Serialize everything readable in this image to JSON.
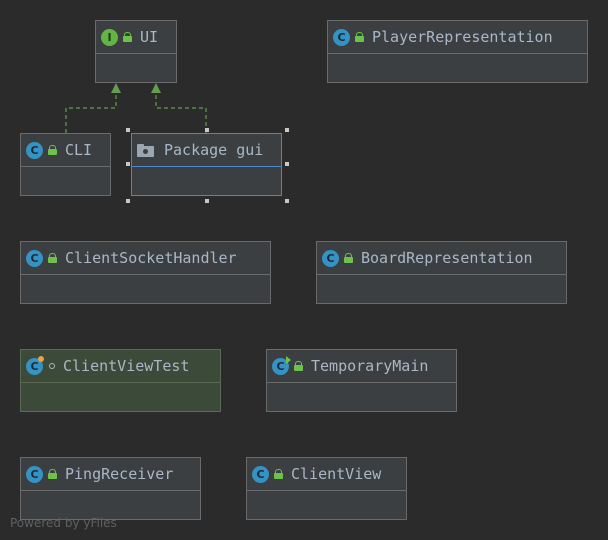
{
  "nodes": {
    "ui": {
      "name": "UI",
      "kind": "interface",
      "icon": "interface-icon",
      "icon_letter": "I"
    },
    "player_representation": {
      "name": "PlayerRepresentation",
      "kind": "class",
      "icon": "class-icon",
      "icon_letter": "C"
    },
    "cli": {
      "name": "CLI",
      "kind": "class",
      "icon": "class-icon",
      "icon_letter": "C"
    },
    "package_gui": {
      "name": "Package gui",
      "kind": "package",
      "icon": "folder-icon"
    },
    "client_socket_handler": {
      "name": "ClientSocketHandler",
      "kind": "class",
      "icon": "class-icon",
      "icon_letter": "C"
    },
    "board_representation": {
      "name": "BoardRepresentation",
      "kind": "class",
      "icon": "class-icon",
      "icon_letter": "C"
    },
    "client_view_test": {
      "name": "ClientViewTest",
      "kind": "test-class",
      "icon": "test-class-icon",
      "icon_letter": "C"
    },
    "temporary_main": {
      "name": "TemporaryMain",
      "kind": "main-class",
      "icon": "runnable-class-icon",
      "icon_letter": "C"
    },
    "ping_receiver": {
      "name": "PingReceiver",
      "kind": "class",
      "icon": "class-icon",
      "icon_letter": "C"
    },
    "client_view": {
      "name": "ClientView",
      "kind": "class",
      "icon": "class-icon",
      "icon_letter": "C"
    }
  },
  "edges": [
    {
      "from": "cli",
      "to": "ui",
      "type": "implements"
    },
    {
      "from": "package_gui",
      "to": "ui",
      "type": "implements"
    }
  ],
  "selected_node": "package_gui",
  "footer": {
    "powered_by": "Powered by yFiles"
  },
  "colors": {
    "background": "#2b2b2b",
    "node_fill": "#3c3f41",
    "node_border": "#6a6a6a",
    "selected_border": "#4a88c7",
    "test_fill": "#3c4a3a",
    "edge": "#62a050",
    "text": "#a9b7c6"
  }
}
